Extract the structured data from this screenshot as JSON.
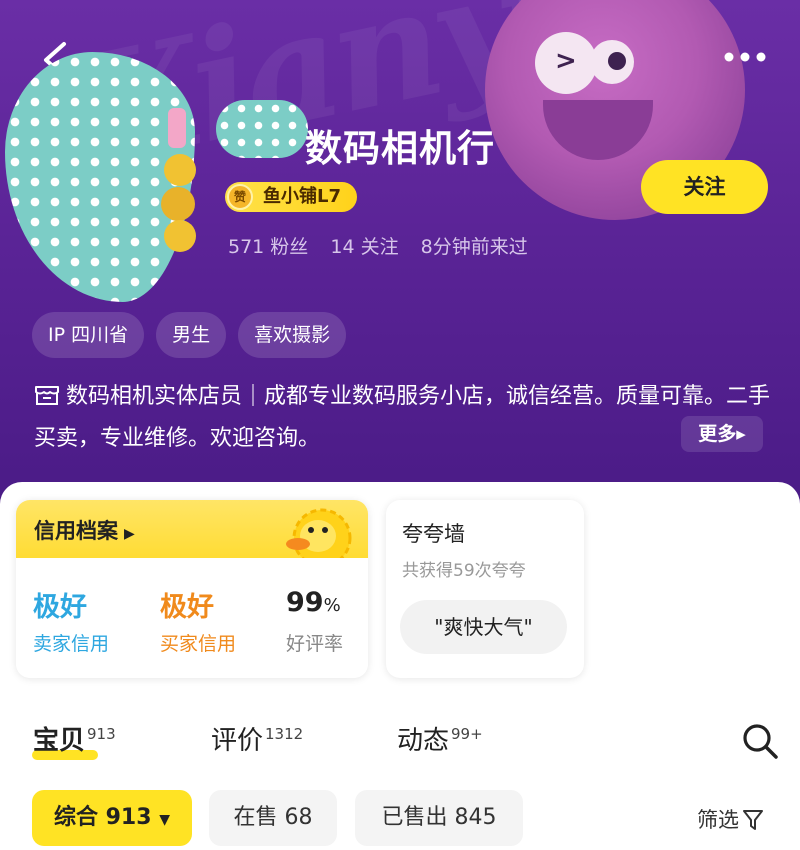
{
  "header": {
    "shop_name": "数码相机行",
    "level_badge": "鱼小铺L7",
    "level_badge_icon_text": "赞",
    "stats": {
      "fans": "571 粉丝",
      "following": "14 关注",
      "last_seen": "8分钟前来过"
    },
    "follow_button": "关注",
    "tags": [
      "IP 四川省",
      "男生",
      "喜欢摄影"
    ],
    "bio": {
      "title": "数码相机实体店员",
      "text": "成都专业数码服务小店，诚信经营。质量可靠。二手买卖，专业维修。欢迎咨询。",
      "more_button": "更多"
    },
    "watermark": "Xianyu"
  },
  "credit": {
    "title": "信用档案",
    "items": [
      {
        "value": "极好",
        "label": "卖家信用",
        "color": "#2ea7e0"
      },
      {
        "value": "极好",
        "label": "买家信用",
        "color": "#f08a1c"
      },
      {
        "value": "99",
        "unit": "%",
        "label": "好评率",
        "color": "#222222"
      }
    ]
  },
  "praise": {
    "title": "夸夸墙",
    "subtitle": "共获得59次夸夸",
    "pill": "\"爽快大气\""
  },
  "tabs": [
    {
      "label": "宝贝",
      "count": "913"
    },
    {
      "label": "评价",
      "count": "1312"
    },
    {
      "label": "动态",
      "count": "99+"
    }
  ],
  "filters": {
    "items": [
      "综合 913",
      "在售 68",
      "已售出 845"
    ],
    "filter_label": "筛选"
  },
  "colors": {
    "accent_yellow": "#ffe324",
    "header_purple": "#5b2497",
    "seller_credit": "#2ea7e0",
    "buyer_credit": "#f08a1c"
  }
}
